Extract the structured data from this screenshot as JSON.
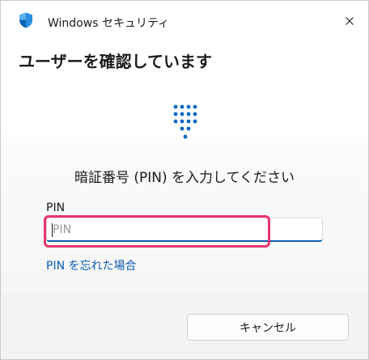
{
  "window": {
    "title": "Windows セキュリティ",
    "app_icon": "shield-icon",
    "close_icon": "close-icon"
  },
  "dialog": {
    "heading": "ユーザーを確認しています",
    "keypad_icon": "pin-keypad-icon",
    "prompt": "暗証番号 (PIN) を入力してください",
    "pin_label": "PIN",
    "pin_placeholder": "PIN",
    "pin_value": "",
    "forgot_link": "PIN を忘れた場合",
    "cancel_label": "キャンセル"
  },
  "colors": {
    "accent": "#0b5cad",
    "keypad_dot": "#0067c0",
    "highlight": "#e8356c",
    "footer_bg": "#f3f3f3"
  }
}
